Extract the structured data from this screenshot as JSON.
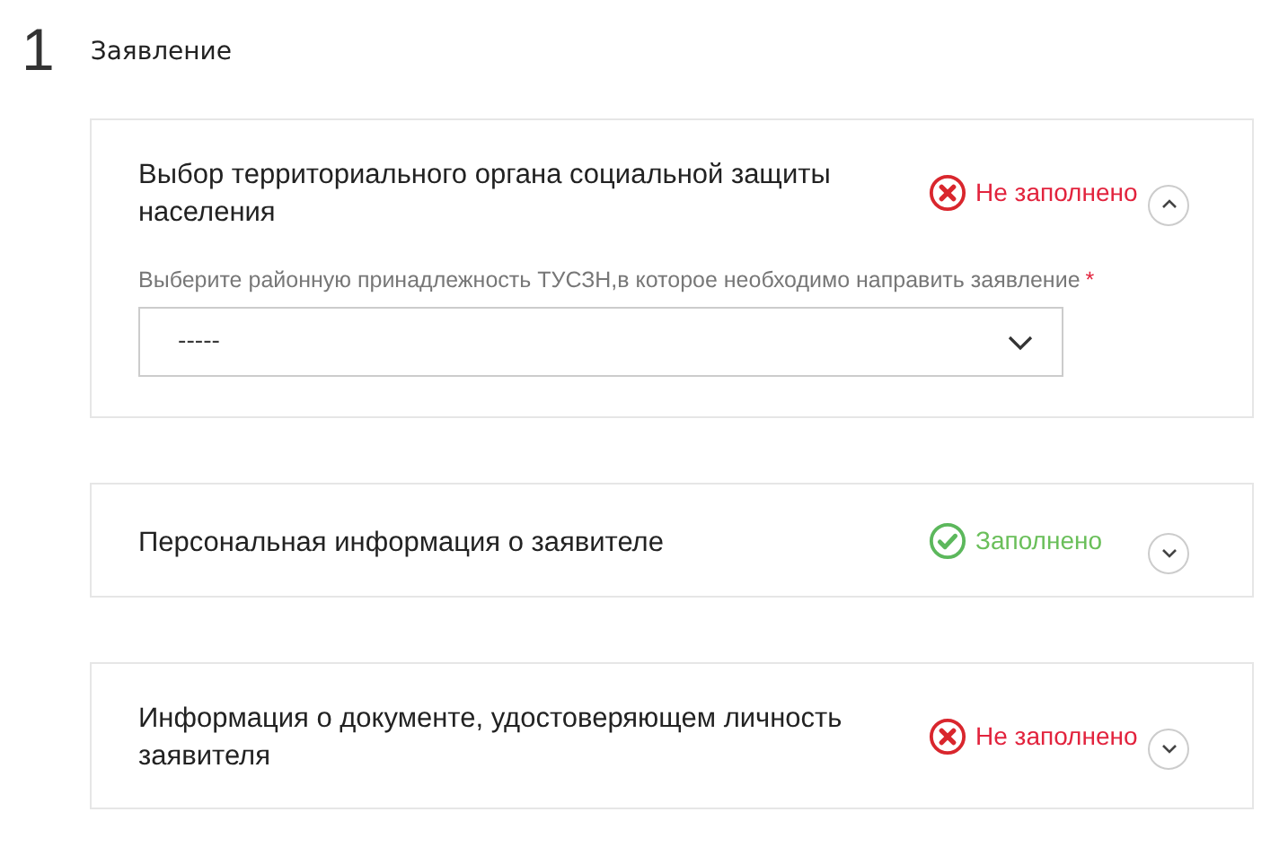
{
  "step": {
    "number": "1",
    "title": "Заявление"
  },
  "sections": [
    {
      "title": "Выбор территориального органа социальной защиты населения",
      "status": {
        "kind": "empty",
        "label": "Не заполнено"
      },
      "expanded": true,
      "field": {
        "label": "Выберите районную принадлежность ТУСЗН,в которое необходимо направить заявление",
        "required": true,
        "required_mark": "*",
        "value": "-----"
      }
    },
    {
      "title": "Персональная информация о заявителе",
      "status": {
        "kind": "filled",
        "label": "Заполнено"
      },
      "expanded": false
    },
    {
      "title": "Информация о документе, удостоверяющем личность заявителя",
      "status": {
        "kind": "empty",
        "label": "Не заполнено"
      },
      "expanded": false
    }
  ]
}
